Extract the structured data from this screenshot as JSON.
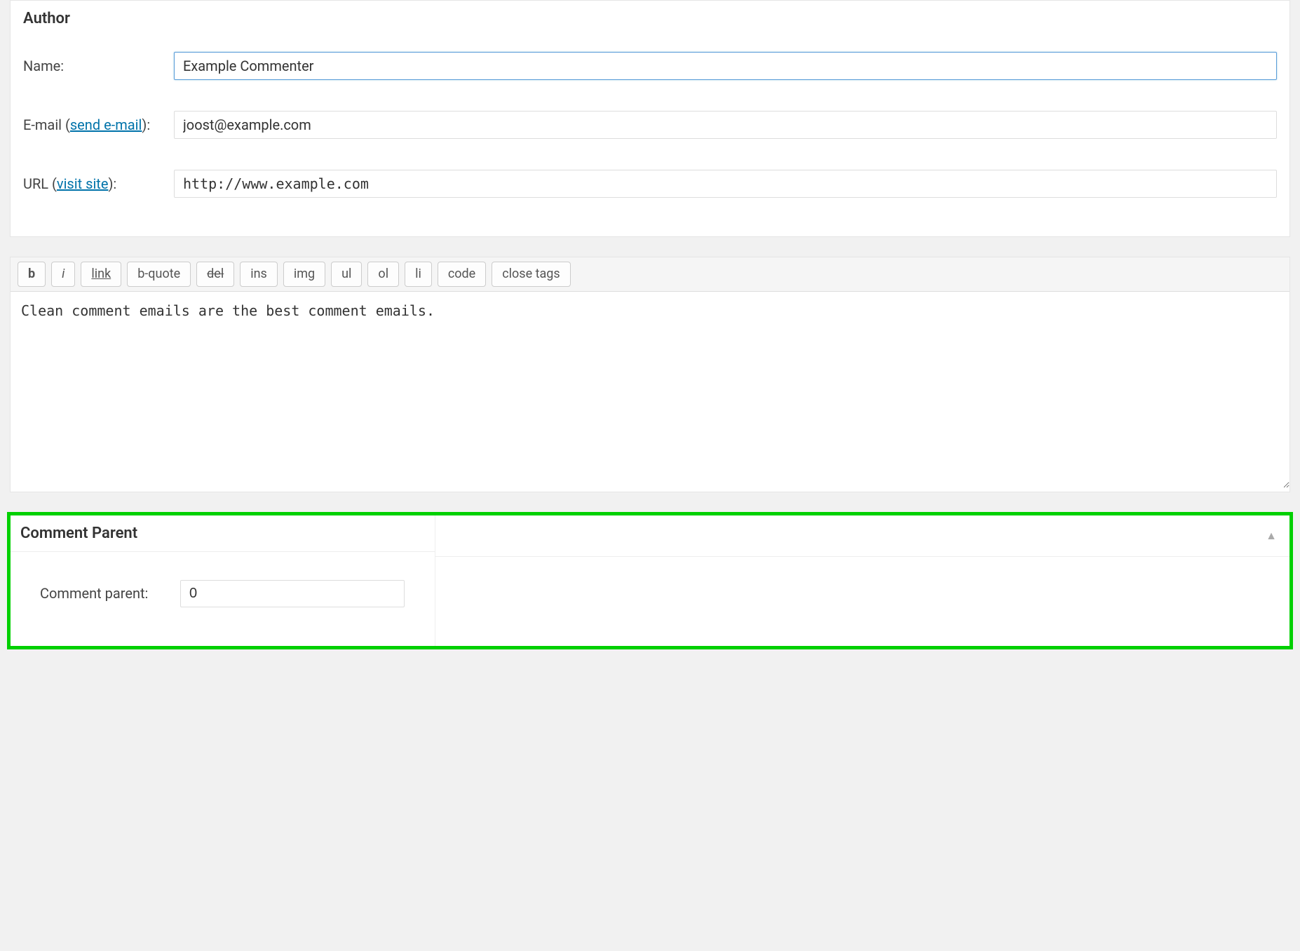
{
  "author": {
    "title": "Author",
    "name_label": "Name:",
    "name_value": "Example Commenter",
    "email_label_before": "E-mail (",
    "email_link": "send e-mail",
    "email_label_after": "):",
    "email_value": "joost@example.com",
    "url_label_before": "URL (",
    "url_link": "visit site",
    "url_label_after": "):",
    "url_value": "http://www.example.com"
  },
  "quicktags": {
    "b": "b",
    "i": "i",
    "link": "link",
    "bquote": "b-quote",
    "del": "del",
    "ins": "ins",
    "img": "img",
    "ul": "ul",
    "ol": "ol",
    "li": "li",
    "code": "code",
    "close": "close tags"
  },
  "editor": {
    "content": "Clean comment emails are the best comment emails."
  },
  "comment_parent": {
    "title": "Comment Parent",
    "label": "Comment parent:",
    "value": "0",
    "toggle_glyph": "▲"
  }
}
